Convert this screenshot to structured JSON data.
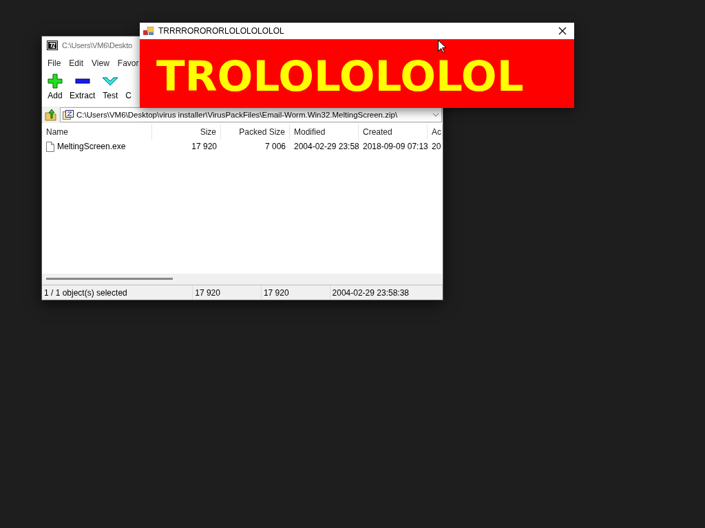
{
  "archive_window": {
    "title": "C:\\Users\\VM6\\Deskto",
    "menu": [
      "File",
      "Edit",
      "View",
      "Favor"
    ],
    "toolbar": [
      {
        "kind": "add",
        "label": "Add"
      },
      {
        "kind": "extract",
        "label": "Extract"
      },
      {
        "kind": "test",
        "label": "Test"
      },
      {
        "kind": "partial",
        "label": "C"
      }
    ],
    "address": "C:\\Users\\VM6\\Desktop\\virus installer\\VirusPackFiles\\Email-Worm.Win32.MeltingScreen.zip\\",
    "table": {
      "columns": [
        {
          "label": "Name"
        },
        {
          "label": "Size"
        },
        {
          "label": "Packed Size"
        },
        {
          "label": "Modified"
        },
        {
          "label": "Created"
        },
        {
          "label": "Ac"
        }
      ],
      "rows": [
        {
          "cells": [
            "MeltingScreen.exe",
            "17 920",
            "7 006",
            "2004-02-29 23:58",
            "2018-09-09 07:13",
            "20"
          ]
        }
      ]
    },
    "status_bar": [
      "1 / 1 object(s) selected",
      "17 920",
      "17 920",
      "2004-02-29 23:58:38"
    ]
  },
  "popup_window": {
    "title": "TRRRRORORORLOLOLOLOLOL",
    "message": "TROLOLOLOLOL"
  }
}
